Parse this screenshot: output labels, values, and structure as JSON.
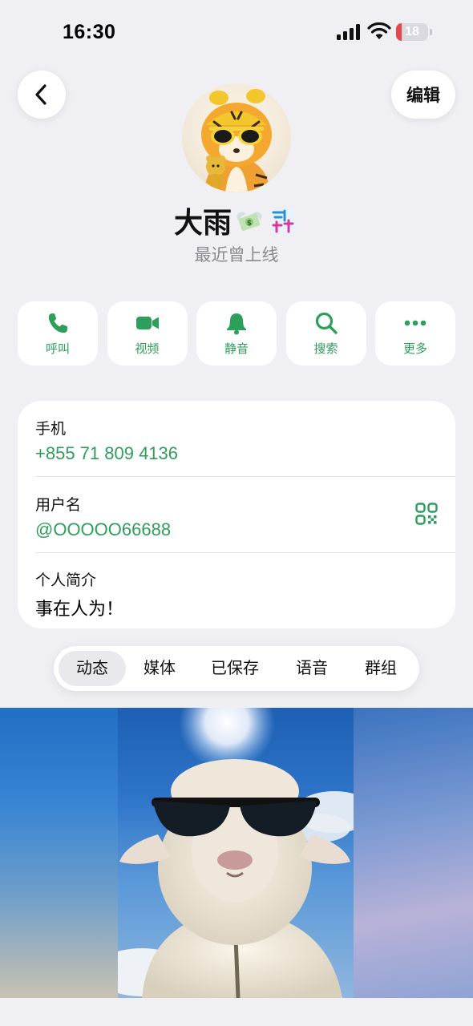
{
  "status_bar": {
    "time": "16:30",
    "battery_level": "18",
    "battery_fraction": 0.18
  },
  "nav": {
    "back_label": "",
    "edit_label": "编辑"
  },
  "profile": {
    "name": "大雨",
    "last_seen": "最近曾上线"
  },
  "actions": [
    {
      "label": "呼叫",
      "icon": "phone-icon"
    },
    {
      "label": "视频",
      "icon": "video-icon"
    },
    {
      "label": "静音",
      "icon": "bell-icon"
    },
    {
      "label": "搜索",
      "icon": "search-icon"
    },
    {
      "label": "更多",
      "icon": "more-icon"
    }
  ],
  "info": {
    "phone_label": "手机",
    "phone_value": "+855 71 809 4136",
    "username_label": "用户名",
    "username_value": "@OOOOO66688",
    "bio_label": "个人简介",
    "bio_value": "事在人为！"
  },
  "tabs": [
    {
      "label": "动态",
      "active": true
    },
    {
      "label": "媒体",
      "active": false
    },
    {
      "label": "已保存",
      "active": false
    },
    {
      "label": "语音",
      "active": false
    },
    {
      "label": "群组",
      "active": false
    }
  ],
  "colors": {
    "accent": "#2e9e5b",
    "background": "#efeff4",
    "battery": "#e5484d"
  }
}
